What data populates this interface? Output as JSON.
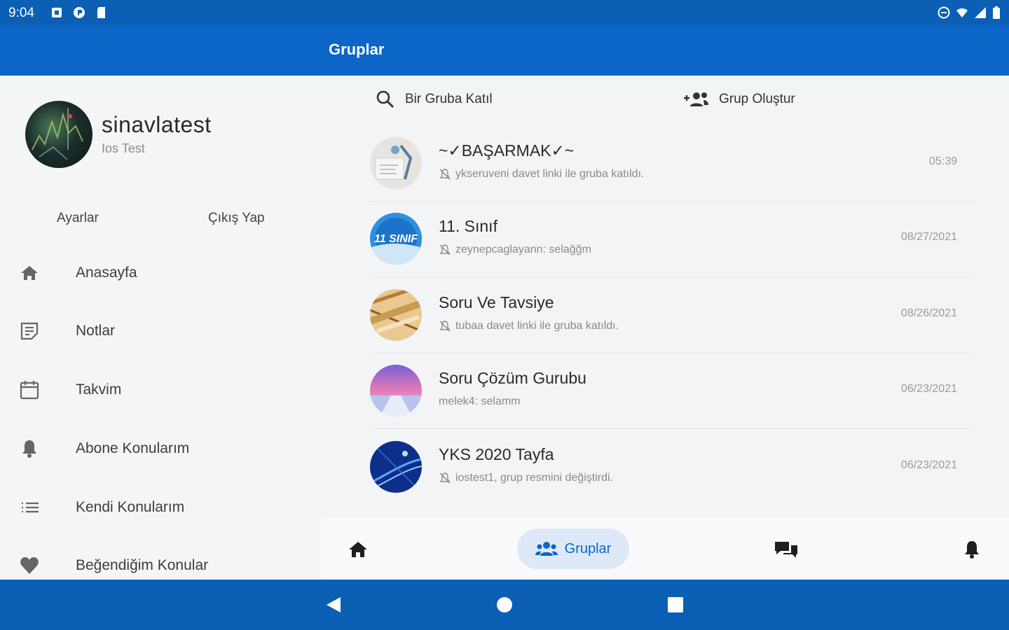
{
  "status_bar": {
    "time": "9:04"
  },
  "app_bar": {
    "title": "Gruplar"
  },
  "profile": {
    "name": "sinavlatest",
    "subtitle": "Ios Test"
  },
  "drawer_links": {
    "settings": "Ayarlar",
    "logout": "Çıkış Yap"
  },
  "menu": [
    {
      "label": "Anasayfa",
      "icon": "home-icon"
    },
    {
      "label": "Notlar",
      "icon": "notes-icon"
    },
    {
      "label": "Takvim",
      "icon": "calendar-icon"
    },
    {
      "label": "Abone Konularım",
      "icon": "bell-icon"
    },
    {
      "label": "Kendi Konularım",
      "icon": "list-icon"
    },
    {
      "label": "Beğendiğim Konular",
      "icon": "heart-icon"
    }
  ],
  "actions": {
    "join": "Bir Gruba Katıl",
    "create": "Grup Oluştur"
  },
  "groups": [
    {
      "name": "~✓BAŞARMAK✓~",
      "message": "ykseruveni davet linki ile gruba katıldı.",
      "time": "05:39",
      "muted": true
    },
    {
      "name": "11. Sınıf",
      "message": "zeynepcaglayann: selağğm",
      "time": "08/27/2021",
      "muted": true
    },
    {
      "name": "Soru Ve Tavsiye",
      "message": "tubaa davet linki ile gruba katıldı.",
      "time": "08/26/2021",
      "muted": true
    },
    {
      "name": "Soru Çözüm Gurubu",
      "message": "melek4: selamm",
      "time": "06/23/2021",
      "muted": false
    },
    {
      "name": "YKS 2020 Tayfa",
      "message": "iostest1, grup resmini değiştirdi.",
      "time": "06/23/2021",
      "muted": true
    }
  ],
  "bottom_nav": {
    "active_label": "Gruplar"
  },
  "colors": {
    "primary": "#0b66c7",
    "status": "#0b5fb5",
    "active_pill": "#dde9f6"
  }
}
